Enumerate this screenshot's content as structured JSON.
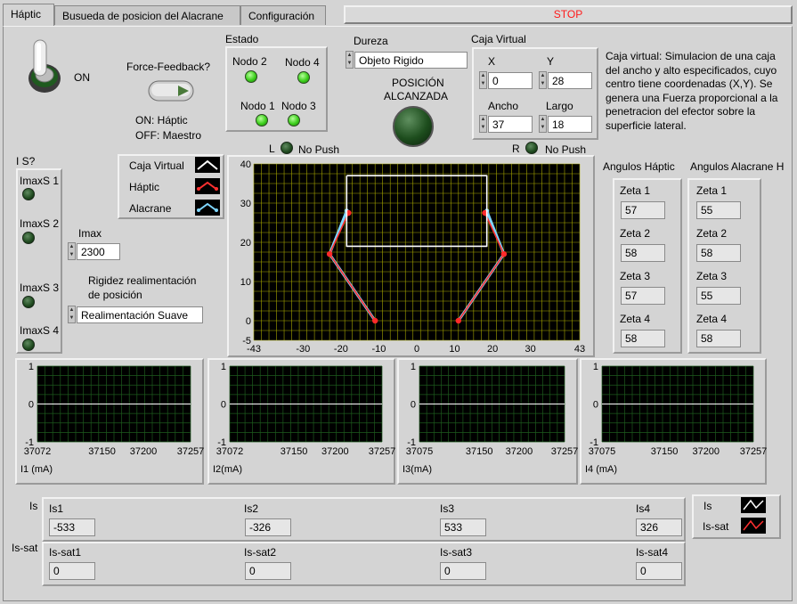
{
  "tabs": [
    "Háptic",
    "Busueda de posicion del Alacrane",
    "Configuración"
  ],
  "stop_label": "STOP",
  "toggle": {
    "state_label": "ON"
  },
  "force_feedback": {
    "label": "Force-Feedback?",
    "legend_on": "ON: Háptic",
    "legend_off": "OFF: Maestro"
  },
  "estado": {
    "title": "Estado",
    "nodes": [
      "Nodo 2",
      "Nodo 4",
      "Nodo 1",
      "Nodo 3"
    ]
  },
  "dureza": {
    "label": "Dureza",
    "value": "Objeto Rigido"
  },
  "posicion": {
    "label_line1": "POSICIÓN",
    "label_line2": "ALCANZADA"
  },
  "caja_virtual": {
    "title": "Caja Virtual",
    "x_label": "X",
    "x_value": "0",
    "y_label": "Y",
    "y_value": "28",
    "ancho_label": "Ancho",
    "ancho_value": "37",
    "largo_label": "Largo",
    "largo_value": "18"
  },
  "description": "Caja virtual: Simulacion de una caja del ancho y alto especificados, cuyo centro tiene coordenadas (X,Y). Se genera una Fuerza proporcional a la penetracion del efector sobre la superficie lateral.",
  "push": {
    "l_label": "L",
    "r_label": "R",
    "l_text": "No Push",
    "r_text": "No Push"
  },
  "is_panel": {
    "title": "I S?",
    "items": [
      "ImaxS 1",
      "ImaxS 2",
      "ImaxS 3",
      "ImaxS 4"
    ]
  },
  "imax": {
    "label": "Imax",
    "value": "2300"
  },
  "rigidez": {
    "label_line1": "Rigidez realimentación",
    "label_line2": "de posición",
    "value": "Realimentación Suave"
  },
  "legend": {
    "items": [
      "Caja Virtual",
      "Háptic",
      "Alacrane"
    ]
  },
  "angulos_haptic": {
    "title": "Angulos Háptic",
    "labels": [
      "Zeta 1",
      "Zeta 2",
      "Zeta 3",
      "Zeta 4"
    ],
    "values": [
      "57",
      "58",
      "57",
      "58"
    ]
  },
  "angulos_alacrane": {
    "title": "Angulos Alacrane H",
    "labels": [
      "Zeta 1",
      "Zeta 2",
      "Zeta 3",
      "Zeta 4"
    ],
    "values": [
      "55",
      "58",
      "55",
      "58"
    ]
  },
  "colors": {
    "plot_bg": "#000000",
    "grid_yellow": "#a6a600",
    "grid_green": "#1d5a1d",
    "box_white": "#ffffff",
    "haptic_red": "#ff3030",
    "alacrane_cyan": "#7fd6ff"
  },
  "chart_data": [
    {
      "type": "line",
      "x_ticks": [
        "-43",
        "-30",
        "-20",
        "-10",
        "0",
        "10",
        "20",
        "30",
        "43"
      ],
      "y_ticks": [
        "40",
        "30",
        "20",
        "10",
        "0",
        "-5"
      ],
      "xlim": [
        -43,
        43
      ],
      "ylim": [
        -5,
        40
      ],
      "series": [
        {
          "name": "Caja Virtual",
          "points": [
            [
              -18.5,
              37
            ],
            [
              18.5,
              37
            ],
            [
              18.5,
              19
            ],
            [
              -18.5,
              19
            ],
            [
              -18.5,
              37
            ]
          ]
        },
        {
          "name": "Háptic",
          "points": [
            [
              -11,
              0
            ],
            [
              -23,
              17
            ],
            [
              -18,
              27.5
            ],
            [
              null,
              null
            ],
            [
              11,
              0
            ],
            [
              23,
              17
            ],
            [
              18,
              27.5
            ]
          ]
        },
        {
          "name": "Alacrane",
          "points": [
            [
              -11,
              0
            ],
            [
              -23,
              17
            ],
            [
              -18.5,
              28
            ],
            [
              null,
              null
            ],
            [
              11,
              0
            ],
            [
              23,
              17
            ],
            [
              18.5,
              28
            ]
          ]
        }
      ]
    },
    {
      "type": "line",
      "y_ticks": [
        "1",
        "0",
        "-1"
      ],
      "x_ticks": [
        "37072",
        "37150",
        "37200",
        "37257"
      ],
      "xlim": [
        37072,
        37257
      ],
      "ylim": [
        -1,
        1
      ],
      "xlabel": "I1 (mA)",
      "series": [
        {
          "values": [
            0,
            0
          ]
        }
      ]
    },
    {
      "type": "line",
      "y_ticks": [
        "1",
        "0",
        "-1"
      ],
      "x_ticks": [
        "37072",
        "37150",
        "37200",
        "37257"
      ],
      "xlim": [
        37072,
        37257
      ],
      "ylim": [
        -1,
        1
      ],
      "xlabel": "I2(mA)",
      "series": [
        {
          "values": [
            0,
            0
          ]
        }
      ]
    },
    {
      "type": "line",
      "y_ticks": [
        "1",
        "0",
        "-1"
      ],
      "x_ticks": [
        "37075",
        "37150",
        "37200",
        "37257"
      ],
      "xlim": [
        37075,
        37257
      ],
      "ylim": [
        -1,
        1
      ],
      "xlabel": "I3(mA)",
      "series": [
        {
          "values": [
            0,
            0
          ]
        }
      ]
    },
    {
      "type": "line",
      "y_ticks": [
        "1",
        "0",
        "-1"
      ],
      "x_ticks": [
        "37075",
        "37150",
        "37200",
        "37257"
      ],
      "xlim": [
        37075,
        37257
      ],
      "ylim": [
        -1,
        1
      ],
      "xlabel": "I4 (mA)",
      "series": [
        {
          "values": [
            0,
            0
          ]
        }
      ]
    }
  ],
  "is_section": {
    "label": "Is",
    "labels": [
      "Is1",
      "Is2",
      "Is3",
      "Is4"
    ],
    "values": [
      "-533",
      "-326",
      "533",
      "326"
    ]
  },
  "is_sat_section": {
    "label": "Is-sat",
    "labels": [
      "Is-sat1",
      "Is-sat2",
      "Is-sat3",
      "Is-sat4"
    ],
    "values": [
      "0",
      "0",
      "0",
      "0"
    ]
  },
  "is_legend": {
    "items": [
      "Is",
      "Is-sat"
    ]
  }
}
